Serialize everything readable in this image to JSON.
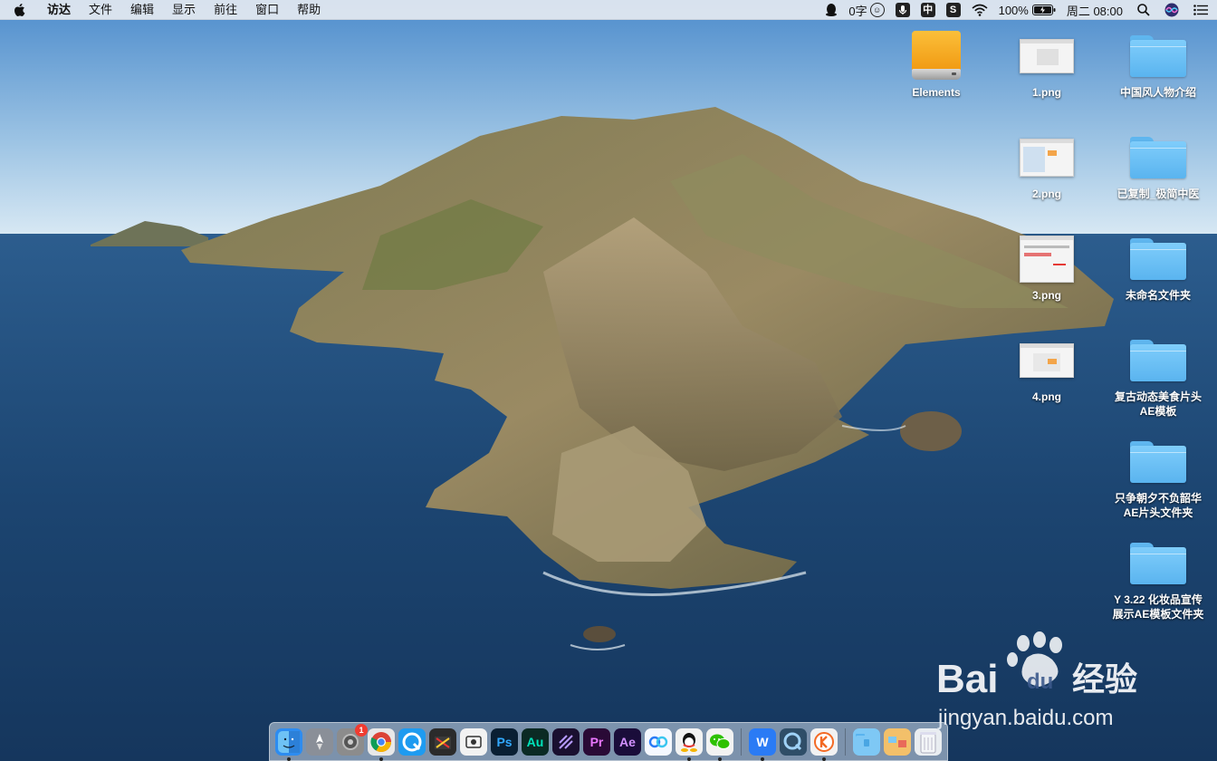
{
  "menubar": {
    "apple_icon": "apple-icon",
    "items": [
      "访达",
      "文件",
      "编辑",
      "显示",
      "前往",
      "窗口",
      "帮助"
    ],
    "status": {
      "word_count": "0字",
      "input_method": "中",
      "battery": "100%",
      "datetime": "周二 08:00"
    }
  },
  "desktop": {
    "icons": [
      {
        "label": "Elements",
        "kind": "drive"
      },
      {
        "label": "1.png",
        "kind": "image"
      },
      {
        "label": "中国风人物介绍",
        "kind": "folder"
      },
      {
        "label": "2.png",
        "kind": "image"
      },
      {
        "label": "已复制_极简中医",
        "kind": "folder"
      },
      {
        "label": "3.png",
        "kind": "image"
      },
      {
        "label": "未命名文件夹",
        "kind": "folder"
      },
      {
        "label": "4.png",
        "kind": "image"
      },
      {
        "label": "复古动态美食片头\nAE模板",
        "kind": "folder"
      },
      {
        "label": "只争朝夕不负韶华\nAE片头文件夹",
        "kind": "folder"
      },
      {
        "label": "Y 3.22 化妆品宣传\n展示AE模板文件夹",
        "kind": "folder"
      }
    ]
  },
  "dock": {
    "apps": [
      {
        "name": "finder",
        "text": "",
        "color": "#2d8cf0",
        "running": true
      },
      {
        "name": "launchpad",
        "text": "",
        "color": "#8a8f98",
        "running": false
      },
      {
        "name": "system-preferences",
        "text": "",
        "color": "#8c8c8c",
        "running": false,
        "badge": "1"
      },
      {
        "name": "chrome",
        "text": "",
        "color": "#e8e8e8",
        "running": true
      },
      {
        "name": "qq-browser",
        "text": "",
        "color": "#1e9bf0",
        "running": false
      },
      {
        "name": "final-cut-pro",
        "text": "",
        "color": "#2b2b2b",
        "running": false
      },
      {
        "name": "screenshot",
        "text": "",
        "color": "#f2f2f2",
        "running": false
      },
      {
        "name": "photoshop",
        "text": "Ps",
        "color": "#0a1f33",
        "running": false
      },
      {
        "name": "audition",
        "text": "Au",
        "color": "#0b2a24",
        "running": false
      },
      {
        "name": "media-encoder",
        "text": "",
        "color": "#1a1030",
        "running": false
      },
      {
        "name": "premiere",
        "text": "Pr",
        "color": "#2a0a36",
        "running": false
      },
      {
        "name": "after-effects",
        "text": "Ae",
        "color": "#1a0d3a",
        "running": false
      },
      {
        "name": "baidu-netdisk",
        "text": "",
        "color": "#f5f8ff",
        "running": false
      },
      {
        "name": "qq",
        "text": "",
        "color": "#f2f2f2",
        "running": true
      },
      {
        "name": "wechat",
        "text": "",
        "color": "#f2f2f2",
        "running": true
      },
      {
        "name": "wps",
        "text": "W",
        "color": "#2a7bf5",
        "running": true
      },
      {
        "name": "quicktime",
        "text": "",
        "color": "#2f4e68",
        "running": false
      },
      {
        "name": "kuaishou",
        "text": "K",
        "color": "#f2f2f2",
        "running": true
      },
      {
        "name": "downloads-folder",
        "text": "",
        "color": "#7ec8f5",
        "running": false
      },
      {
        "name": "photos-folder",
        "text": "",
        "color": "#f3c06a",
        "running": false
      },
      {
        "name": "trash",
        "text": "",
        "color": "#e9edf1",
        "running": false
      }
    ]
  },
  "watermark": {
    "brand": "Bai",
    "brand_suffix": "du",
    "product": "经验",
    "url": "jingyan.baidu.com"
  }
}
